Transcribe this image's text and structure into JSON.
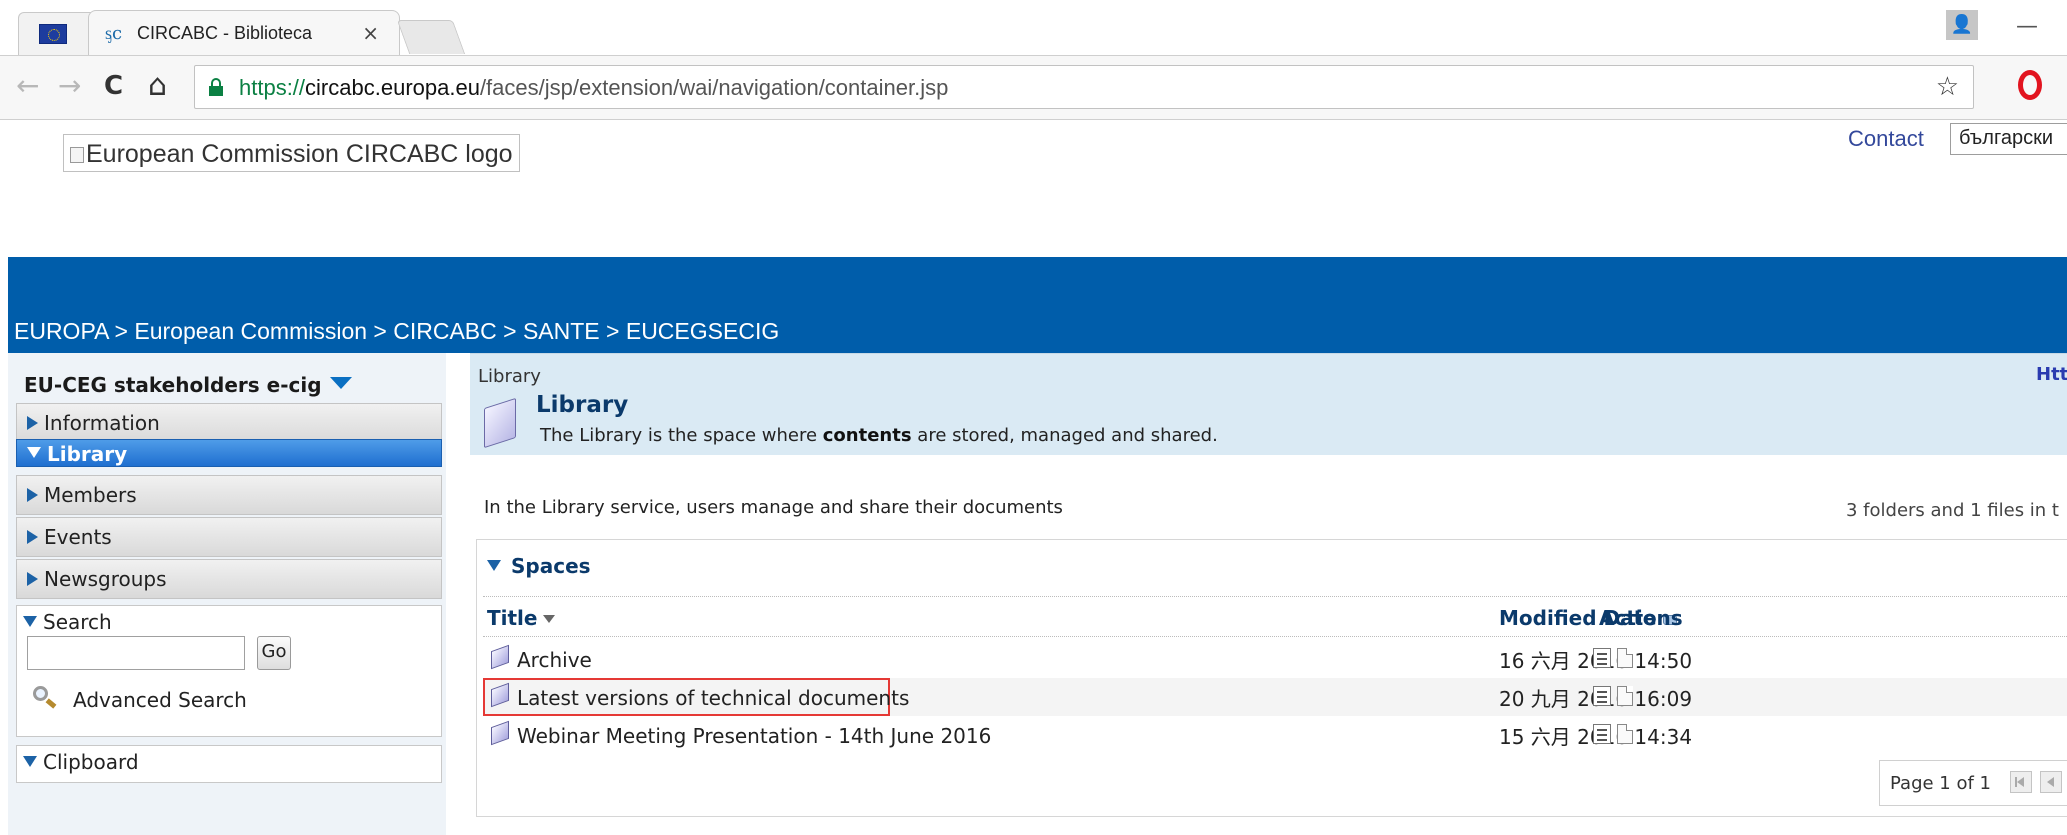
{
  "browser": {
    "tab_title": "CIRCABC - Biblioteca",
    "tab_close": "×",
    "address_secure": "https://",
    "address_host": "circabc.europa.eu",
    "address_path": "/faces/jsp/extension/wai/navigation/container.jsp",
    "window_minimize": "—",
    "window_user": "👤",
    "icons": {
      "back": "←",
      "forward": "→",
      "reload": "C",
      "home": "⌂",
      "bookmark": "☆"
    }
  },
  "header": {
    "logo_alt": "European Commission CIRCABC logo",
    "contact_label": "Contact",
    "language": "български"
  },
  "breadcrumb": "EUROPA > European Commission > CIRCABC  > SANTE > EUCEGSECIG",
  "sidebar": {
    "space_title": "EU-CEG stakeholders e-cig",
    "items": [
      {
        "label": "Information"
      },
      {
        "label": "Library"
      },
      {
        "label": "Members"
      },
      {
        "label": "Events"
      },
      {
        "label": "Newsgroups"
      }
    ],
    "search": {
      "title": "Search",
      "go_label": "Go",
      "advanced_label": "Advanced Search",
      "value": ""
    },
    "clipboard_title": "Clipboard"
  },
  "main": {
    "crumb": "Library",
    "link_fragment": "Htt",
    "title": "Library",
    "description_before": "The Library is the space where ",
    "description_bold": "contents",
    "description_after": " are stored, managed and shared.",
    "intro": "In the Library service, users manage and share their documents",
    "counts": "3 folders and 1 files in t",
    "spaces": {
      "title": "Spaces",
      "columns": {
        "title": "Title",
        "modified": "Modified Date",
        "actions": "Actions"
      },
      "rows": [
        {
          "title": "Archive",
          "date": "16 六月 2016 14:50",
          "highlighted": false
        },
        {
          "title": "Latest versions of technical documents",
          "date": "20 九月 2016 16:09",
          "highlighted": true
        },
        {
          "title": "Webinar Meeting Presentation - 14th June 2016",
          "date": "15 六月 2016 14:34",
          "highlighted": false
        }
      ],
      "pager": "Page 1 of 1"
    }
  },
  "colors": {
    "brand_blue": "#005daa",
    "header_panel": "#daeaf4",
    "highlight_red": "#e53935"
  }
}
